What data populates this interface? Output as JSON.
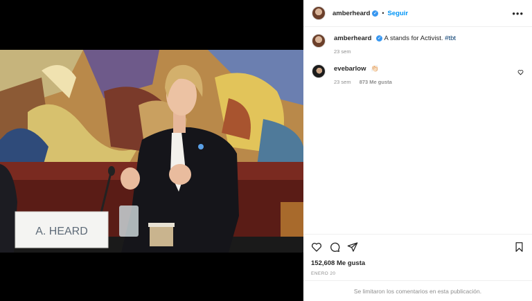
{
  "post": {
    "username": "amberheard",
    "follow_label": "Seguir",
    "separator": "•",
    "more_label": "•••",
    "verified_mark": "✓"
  },
  "caption": {
    "username": "amberheard",
    "text": "A stands for Activist.",
    "hashtag": "#tbt",
    "time": "23 sem"
  },
  "comment": {
    "username": "evebarlow",
    "text": "👏🏻",
    "time": "23 sem",
    "likes": "873 Me gusta"
  },
  "photo": {
    "nameplate": "A. HEARD"
  },
  "footer": {
    "likes": "152,608 Me gusta",
    "date": "ENERO 20",
    "comments_limited": "Se limitaron los comentarios en esta publicación."
  },
  "icons": {
    "like": "heart-icon",
    "comment": "comment-icon",
    "share": "share-icon",
    "save": "bookmark-icon",
    "comment_like": "heart-icon"
  },
  "colors": {
    "link_blue": "#0095f6",
    "verified_blue": "#3897f0",
    "hashtag": "#00376b",
    "muted": "#8e8e8e"
  }
}
